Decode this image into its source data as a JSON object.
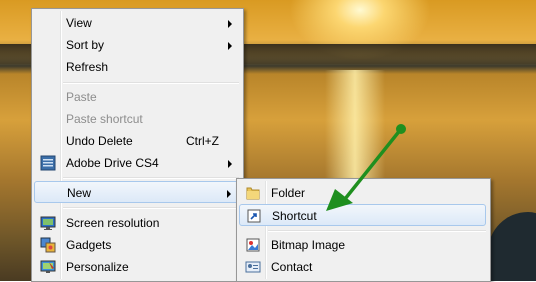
{
  "context_menu": {
    "items": [
      {
        "label": "View"
      },
      {
        "label": "Sort by"
      },
      {
        "label": "Refresh"
      },
      {
        "label": "Paste"
      },
      {
        "label": "Paste shortcut"
      },
      {
        "label": "Undo Delete",
        "shortcut": "Ctrl+Z"
      },
      {
        "label": "Adobe Drive CS4"
      },
      {
        "label": "New"
      },
      {
        "label": "Screen resolution"
      },
      {
        "label": "Gadgets"
      },
      {
        "label": "Personalize"
      }
    ]
  },
  "new_submenu": {
    "items": [
      {
        "label": "Folder"
      },
      {
        "label": "Shortcut"
      },
      {
        "label": "Bitmap Image"
      },
      {
        "label": "Contact"
      }
    ]
  },
  "colors": {
    "annotation_arrow": "#1f8f1f",
    "highlight_border": "#a8c8ec"
  }
}
